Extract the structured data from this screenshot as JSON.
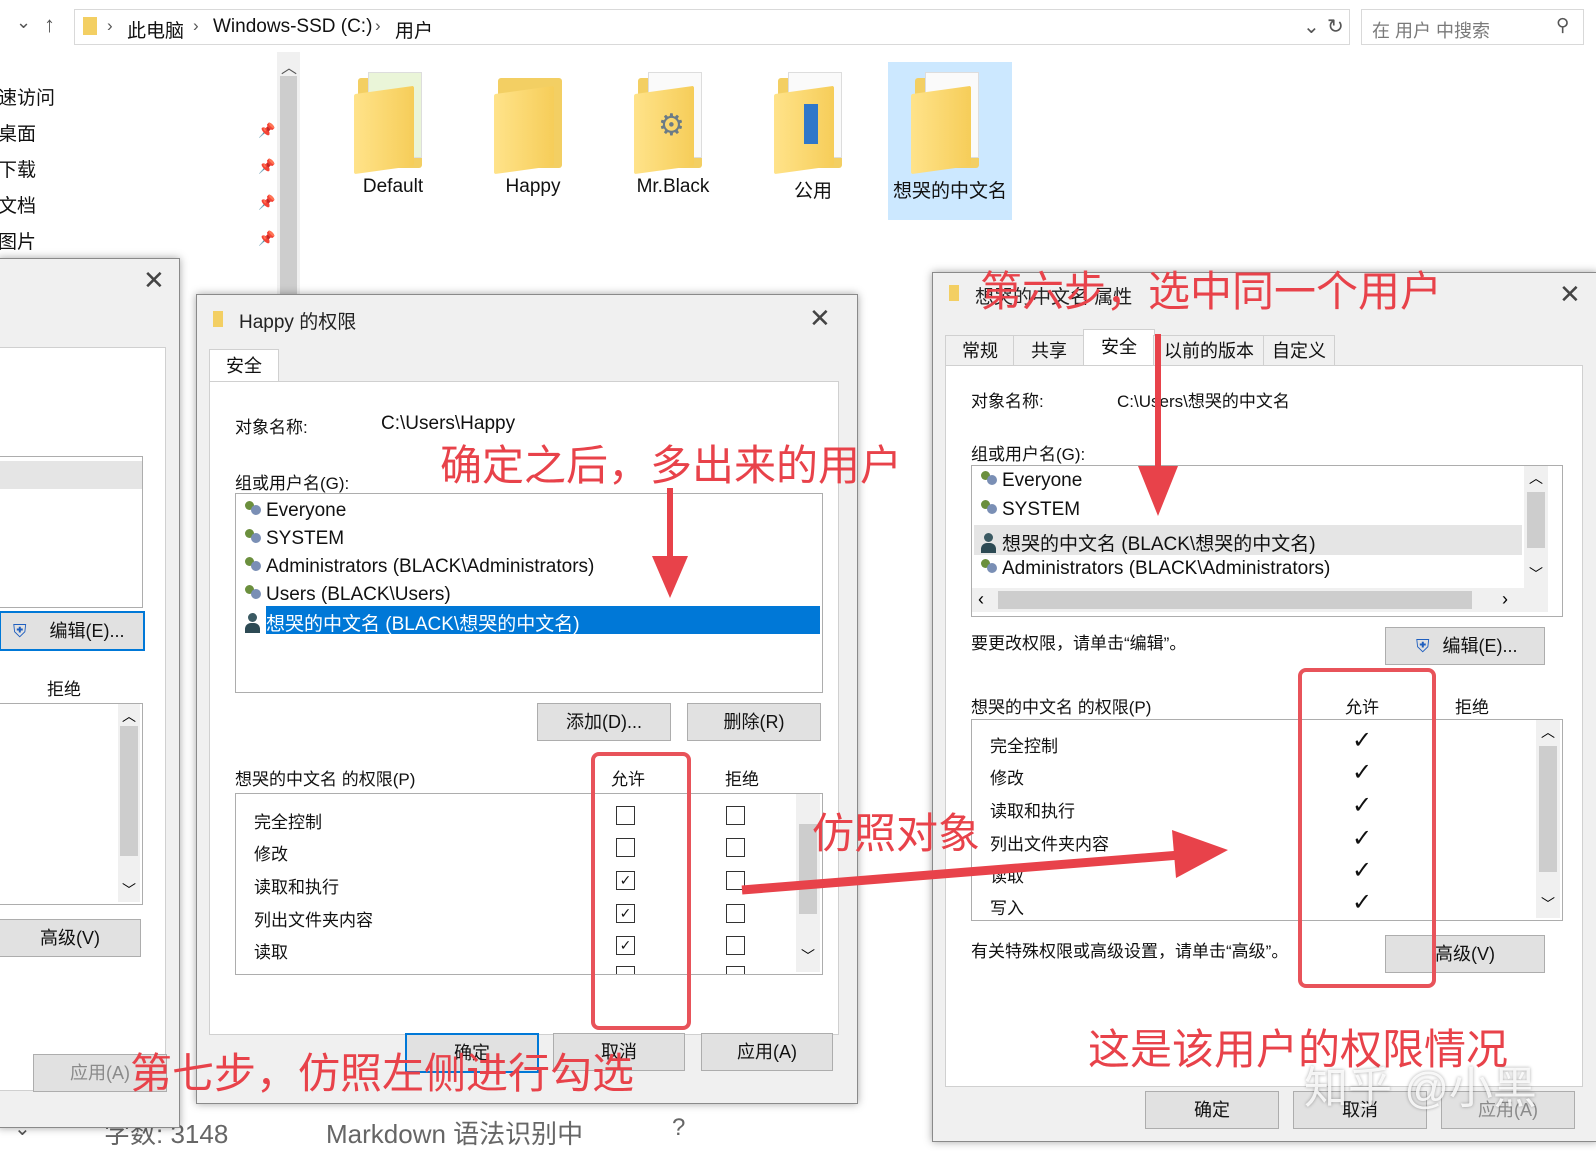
{
  "explorer": {
    "breadcrumb": [
      "此电脑",
      "Windows-SSD (C:)",
      "用户"
    ],
    "search_placeholder": "在 用户 中搜索",
    "nav": [
      "速访问",
      "桌面",
      "下载",
      "文档",
      "图片"
    ],
    "folders": [
      "Default",
      "Happy",
      "Mr.Black",
      "公用",
      "想哭的中文名"
    ]
  },
  "back_dialog": {
    "edit_button": "编辑(E)...",
    "deny_header": "拒绝",
    "advanced_button": "高级(V)",
    "apply_button": "应用(A)"
  },
  "perm_dialog": {
    "title": "Happy 的权限",
    "tab": "安全",
    "object_label": "对象名称:",
    "object_value": "C:\\Users\\Happy",
    "group_label": "组或用户名(G):",
    "users": [
      "Everyone",
      "SYSTEM",
      "Administrators (BLACK\\Administrators)",
      "Users (BLACK\\Users)",
      "想哭的中文名 (BLACK\\想哭的中文名)"
    ],
    "add_button": "添加(D)...",
    "remove_button": "删除(R)",
    "perm_label": "想哭的中文名 的权限(P)",
    "allow_header": "允许",
    "deny_header": "拒绝",
    "permissions": [
      {
        "name": "完全控制",
        "allow": false,
        "deny": false
      },
      {
        "name": "修改",
        "allow": false,
        "deny": false
      },
      {
        "name": "读取和执行",
        "allow": true,
        "deny": false
      },
      {
        "name": "列出文件夹内容",
        "allow": true,
        "deny": false
      },
      {
        "name": "读取",
        "allow": true,
        "deny": false
      }
    ],
    "ok_button": "确定",
    "cancel_button": "取消",
    "apply_button": "应用(A)"
  },
  "props_dialog": {
    "title": "想哭的中文名 属性",
    "tabs": [
      "常规",
      "共享",
      "安全",
      "以前的版本",
      "自定义"
    ],
    "object_label": "对象名称:",
    "object_value": "C:\\Users\\想哭的中文名",
    "group_label": "组或用户名(G):",
    "users": [
      "Everyone",
      "SYSTEM",
      "想哭的中文名 (BLACK\\想哭的中文名)",
      "Administrators (BLACK\\Administrators)"
    ],
    "change_hint": "要更改权限，请单击“编辑”。",
    "edit_button": "编辑(E)...",
    "perm_label": "想哭的中文名 的权限(P)",
    "allow_header": "允许",
    "deny_header": "拒绝",
    "permissions": [
      "完全控制",
      "修改",
      "读取和执行",
      "列出文件夹内容",
      "读取",
      "写入"
    ],
    "advanced_hint": "有关特殊权限或高级设置，请单击“高级”。",
    "advanced_button": "高级(V)",
    "ok_button": "确定",
    "cancel_button": "取消",
    "apply_button": "应用(A)"
  },
  "annotations": {
    "step6": "第六步，选中同一个用户",
    "after_ok": "确定之后，多出来的用户",
    "reference": "仿照对象",
    "step7": "第七步，仿照左侧进行勾选",
    "status": "这是该用户的权限情况"
  },
  "statusbar": {
    "words": "字数: 3148",
    "mode": "Markdown 语法识别中"
  },
  "watermark": "知乎 @小黑",
  "colors": {
    "annotation": "#e8424a",
    "selection": "#0078d7"
  }
}
